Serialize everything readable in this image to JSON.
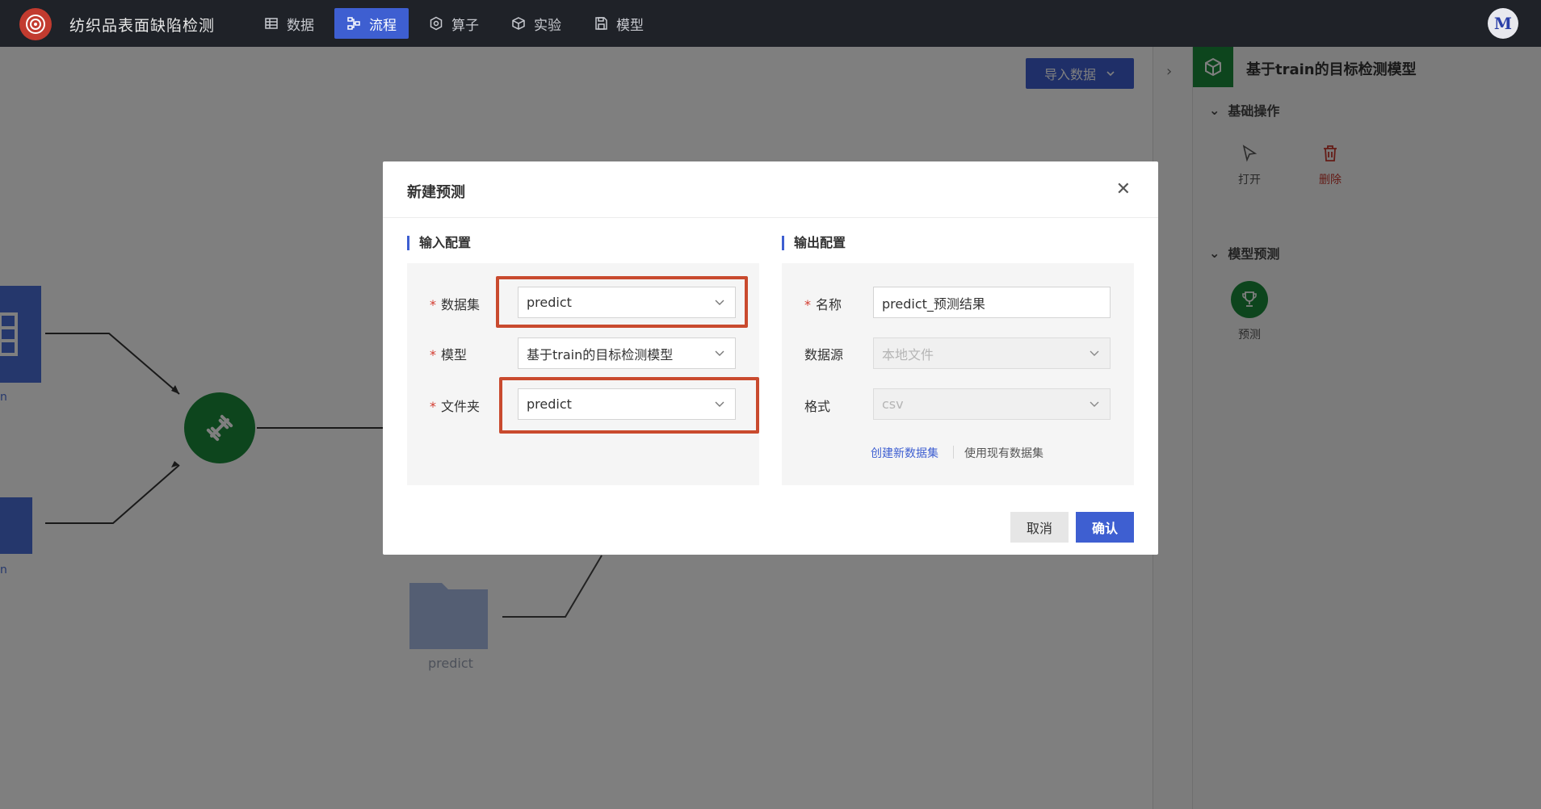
{
  "app": {
    "title": "纺织品表面缺陷检测",
    "avatar_letter": "M"
  },
  "nav": {
    "items": [
      {
        "label": "数据",
        "icon": "table-icon"
      },
      {
        "label": "流程",
        "icon": "flow-icon",
        "active": true
      },
      {
        "label": "算子",
        "icon": "hexagon-icon"
      },
      {
        "label": "实验",
        "icon": "cube-icon"
      },
      {
        "label": "模型",
        "icon": "save-icon"
      }
    ]
  },
  "canvas": {
    "import_button": "导入数据",
    "node_label_partial": "n",
    "folder_node_label": "predict"
  },
  "right_panel": {
    "title": "基于train的目标检测模型",
    "section_basic": "基础操作",
    "action_open": "打开",
    "action_delete": "删除",
    "section_predict": "模型预测",
    "action_predict": "预测"
  },
  "modal": {
    "title": "新建预测",
    "input_config_title": "输入配置",
    "output_config_title": "输出配置",
    "dataset_label": "数据集",
    "dataset_value": "predict",
    "model_label": "模型",
    "model_value": "基于train的目标检测模型",
    "folder_label": "文件夹",
    "folder_value": "predict",
    "name_label": "名称",
    "name_value": "predict_预测结果",
    "datasource_label": "数据源",
    "datasource_value": "本地文件",
    "format_label": "格式",
    "format_value": "csv",
    "link_create_new": "创建新数据集",
    "link_use_existing": "使用现有数据集",
    "cancel_button": "取消",
    "confirm_button": "确认",
    "required_mark": "*"
  },
  "colors": {
    "accent": "#3e5fd1",
    "success": "#1a8a3a",
    "danger": "#d33b30",
    "highlight_box": "#c94a2e"
  }
}
